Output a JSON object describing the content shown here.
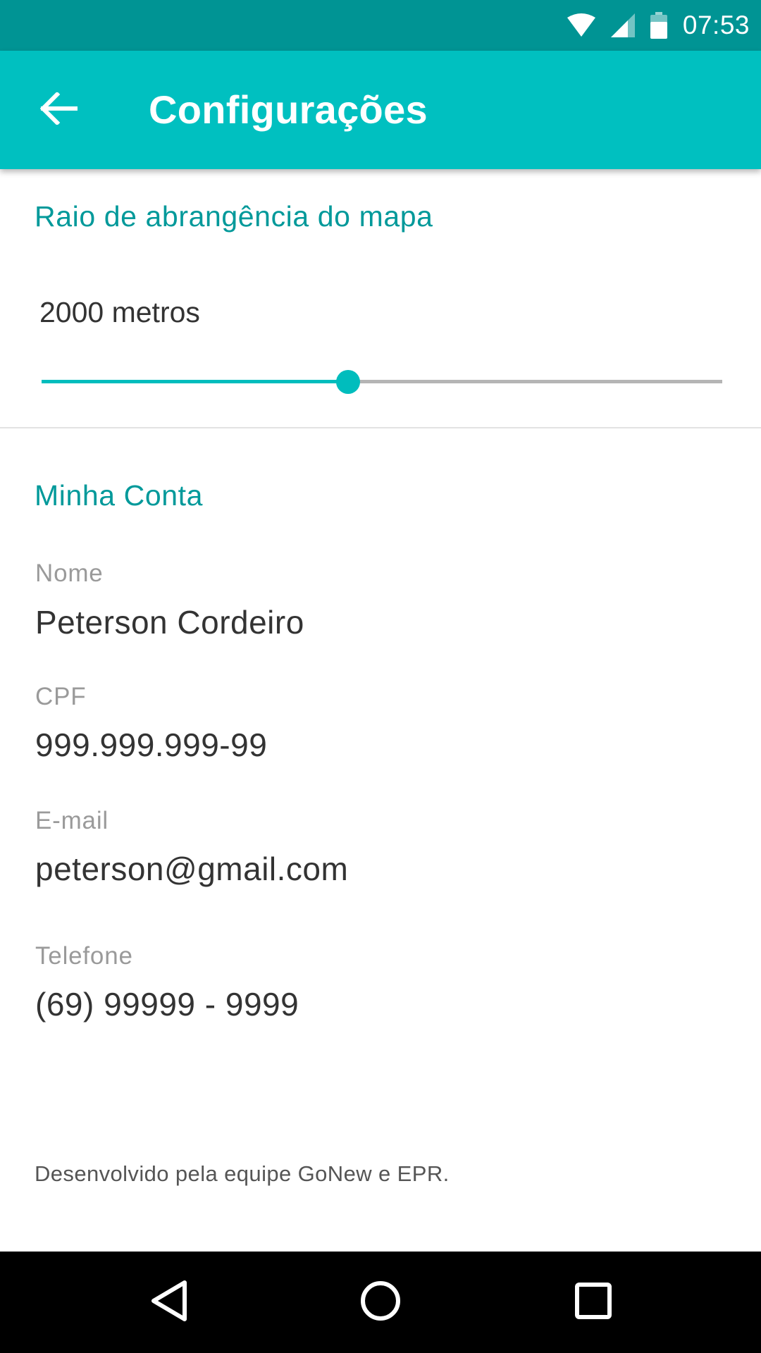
{
  "status_bar": {
    "time": "07:53",
    "icons": [
      "wifi-icon",
      "cell-signal-icon",
      "battery-icon"
    ]
  },
  "toolbar": {
    "back_icon": "arrow-back-icon",
    "title": "Configurações"
  },
  "map_radius": {
    "section_title": "Raio de abrangência do mapa",
    "value_text": "2000 metros",
    "slider_fraction": 0.45
  },
  "account": {
    "section_title": "Minha Conta",
    "fields": [
      {
        "label": "Nome",
        "value": "Peterson Cordeiro"
      },
      {
        "label": "CPF",
        "value": "999.999.999-99"
      },
      {
        "label": "E-mail",
        "value": "peterson@gmail.com"
      },
      {
        "label": "Telefone",
        "value": "(69) 99999 - 9999"
      }
    ]
  },
  "footer": {
    "text": "Desenvolvido pela equipe GoNew e EPR."
  },
  "nav_bar": {
    "buttons": [
      "back-triangle-icon",
      "home-circle-icon",
      "recents-square-icon"
    ]
  },
  "colors": {
    "status_bar": "#009494",
    "toolbar": "#00C0C0",
    "accent": "#00BDBD",
    "section_title": "#00999A"
  }
}
